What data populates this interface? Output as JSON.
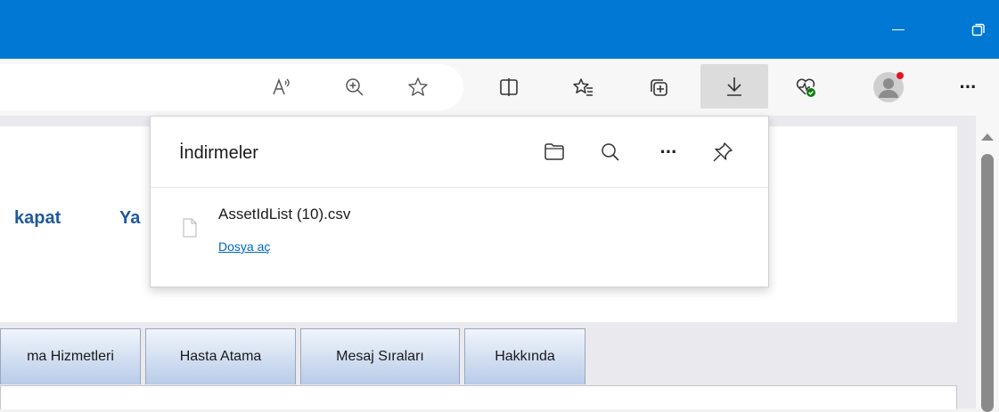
{
  "window": {
    "minimize_label": "–",
    "restore_icon": "restore-icon"
  },
  "toolbar": {
    "icons": [
      "read-aloud-icon",
      "zoom-icon",
      "favorite-star-icon",
      "split-screen-icon",
      "favorites-icon",
      "collections-icon",
      "downloads-icon",
      "browser-essentials-icon",
      "profile-icon",
      "more-icon"
    ],
    "more_label": "···"
  },
  "page": {
    "header_links": [
      "kapat",
      "Ya"
    ],
    "tabs": [
      "ma Hizmetleri",
      "Hasta Atama",
      "Mesaj Sıraları",
      "Hakkında"
    ]
  },
  "downloads": {
    "title": "İndirmeler",
    "more_label": "···",
    "items": [
      {
        "name": "AssetIdList (10).csv",
        "action": "Dosya aç"
      }
    ]
  },
  "colors": {
    "titlebar": "#0078d4",
    "link": "#1f5a9c",
    "open_link": "#0067c0",
    "notification_dot": "#e81123"
  }
}
